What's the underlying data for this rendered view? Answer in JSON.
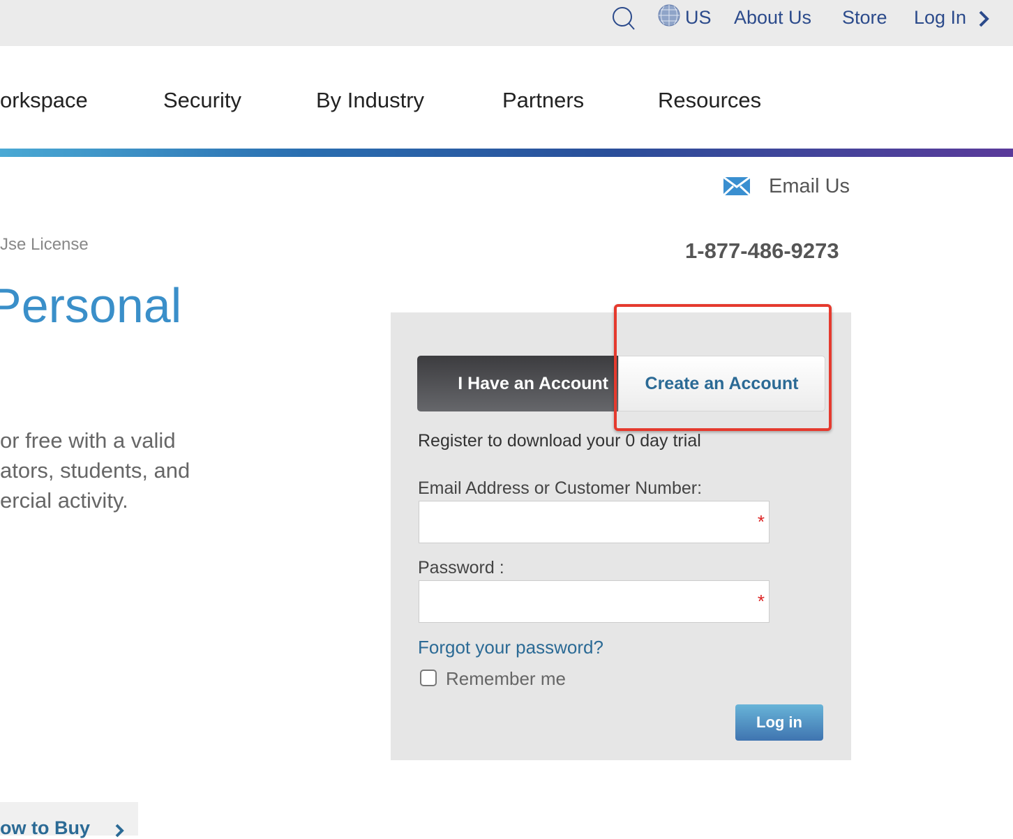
{
  "topbar": {
    "region": "US",
    "links": [
      "About Us",
      "Store",
      "Log In"
    ],
    "icons": {
      "search": "search-icon",
      "globe": "globe-icon",
      "chevron": "chevron-right-icon"
    }
  },
  "nav": {
    "items": [
      "orkspace",
      "Security",
      "By Industry",
      "Partners",
      "Resources"
    ]
  },
  "contact": {
    "email_label": "Email Us",
    "phone": "1-877-486-9273"
  },
  "hero": {
    "breadcrumb": "Jse License",
    "title": "Personal",
    "description": [
      "or free with a valid",
      "ators, students, and",
      "ercial activity."
    ]
  },
  "login_panel": {
    "tabs": [
      {
        "label": "I Have an Account",
        "active": true
      },
      {
        "label": "Create an Account",
        "active": false,
        "highlighted": true
      }
    ],
    "subtitle": "Register to download your 0 day trial",
    "email_label": "Email Address or Customer Number:",
    "email_value": "",
    "password_label": "Password :",
    "password_value": "",
    "required_mark": "*",
    "forgot_link": "Forgot your password?",
    "remember_label": "Remember me",
    "remember_checked": false,
    "submit_label": "Log in"
  },
  "footer": {
    "how_to_buy": "ow to Buy"
  },
  "colors": {
    "link": "#2b4a8b",
    "accent": "#3a8fc9",
    "highlight": "#e53a2e",
    "tab_active": "#4a4a4d"
  }
}
